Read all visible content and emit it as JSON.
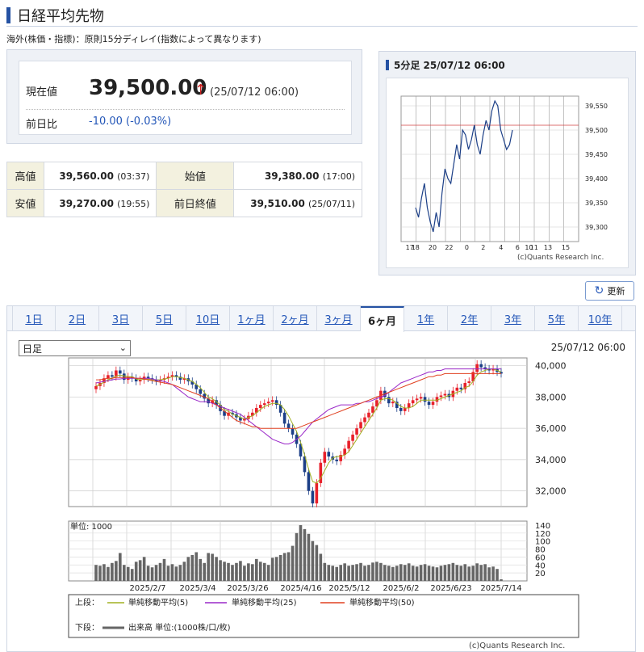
{
  "header": {
    "title": "日経平均先物",
    "note": "海外(株価・指標)：原則15分ディレイ(指数によって異なります)"
  },
  "quote": {
    "current_label": "現在値",
    "price": "39,500.00",
    "arrow": "↑",
    "date": "(25/07/12 06:00)",
    "change_label": "前日比",
    "change": "-10.00 (-0.03%)"
  },
  "stats": {
    "high_label": "高値",
    "high": "39,560.00",
    "high_time": "(03:37)",
    "open_label": "始値",
    "open": "39,380.00",
    "open_time": "(17:00)",
    "low_label": "安値",
    "low": "39,270.00",
    "low_time": "(19:55)",
    "prev_label": "前日終値",
    "prev": "39,510.00",
    "prev_time": "(25/07/11)"
  },
  "intraday": {
    "title": "5分足 25/07/12 06:00",
    "copyright": "(c)Quants Research Inc.",
    "x_ticks": [
      "17",
      "18",
      "20",
      "22",
      "0",
      "2",
      "4",
      "6",
      "10",
      "11",
      "13",
      "15"
    ],
    "y_ticks": [
      "39,550",
      "39,500",
      "39,450",
      "39,400",
      "39,350",
      "39,300"
    ]
  },
  "refresh_label": "更新",
  "tabs": [
    "1日",
    "2日",
    "3日",
    "5日",
    "10日",
    "1ヶ月",
    "2ヶ月",
    "3ヶ月",
    "6ヶ月",
    "1年",
    "2年",
    "3年",
    "5年",
    "10年"
  ],
  "active_tab": "6ヶ月",
  "select_value": "日足",
  "chart_date": "25/07/12 06:00",
  "legend": {
    "upper_label": "上段：",
    "sma5": "単純移動平均(5)",
    "sma25": "単純移動平均(25)",
    "sma50": "単純移動平均(50)",
    "lower_label": "下段：",
    "volume": "出来高 単位:(1000株/口/枚)"
  },
  "volume_unit": "単位: 1000",
  "copyright": "(c)Quants Research Inc.",
  "colors": {
    "up": "#e8202a",
    "down": "#1c3f87",
    "sma5": "#a0b020",
    "sma25": "#9a28c8",
    "sma50": "#e04020",
    "accent": "#2552a3"
  },
  "chart_data": [
    {
      "type": "line",
      "title": "5分足 25/07/12 06:00",
      "y_ticks": [
        39300,
        39350,
        39400,
        39450,
        39500,
        39550
      ],
      "ylim": [
        39270,
        39570
      ],
      "x_ticks": [
        "17",
        "18",
        "20",
        "22",
        "0",
        "2",
        "4",
        "6",
        "10",
        "11",
        "13",
        "15"
      ],
      "reference_line": 39510,
      "series": [
        {
          "values": [
            39340,
            39320,
            39360,
            39390,
            39340,
            39310,
            39290,
            39330,
            39300,
            39370,
            39420,
            39400,
            39390,
            39430,
            39470,
            39440,
            39500,
            39490,
            39460,
            39480,
            39510,
            39470,
            39450,
            39490,
            39520,
            39500,
            39540,
            39560,
            39550,
            39500,
            39480,
            39460,
            39470,
            39500
          ]
        }
      ]
    },
    {
      "type": "candlestick",
      "title": "日足",
      "ylim": [
        31000,
        40500
      ],
      "y_ticks": [
        32000,
        34000,
        36000,
        38000,
        40000
      ],
      "x_ticks": [
        "2025/2/7",
        "2025/3/4",
        "2025/3/26",
        "2025/4/16",
        "2025/5/12",
        "2025/6/2",
        "2025/6/23",
        "2025/7/14"
      ],
      "close": [
        38700,
        38900,
        39200,
        39400,
        39300,
        39700,
        39500,
        39100,
        39300,
        39200,
        39000,
        39100,
        39300,
        39200,
        39100,
        39000,
        39100,
        39200,
        39300,
        39400,
        39300,
        39100,
        39200,
        39000,
        38800,
        38500,
        38200,
        37900,
        37600,
        37800,
        37500,
        37100,
        36800,
        37000,
        36900,
        36700,
        36500,
        36600,
        36800,
        37000,
        37300,
        37500,
        37600,
        37700,
        37800,
        37500,
        37000,
        36300,
        36000,
        35600,
        35000,
        34200,
        33200,
        32000,
        31200,
        32500,
        33800,
        34500,
        34200,
        34000,
        33900,
        34300,
        34700,
        35200,
        35600,
        36000,
        36400,
        36700,
        37000,
        37400,
        37800,
        38400,
        38000,
        37600,
        37700,
        37300,
        37100,
        37300,
        37600,
        37800,
        37900,
        38000,
        37700,
        37500,
        37700,
        38000,
        38100,
        38200,
        38000,
        38400,
        38600,
        38500,
        38900,
        39000,
        39600,
        40100,
        39900,
        39800,
        39700,
        39800,
        39600,
        39500
      ],
      "series": [
        {
          "name": "単純移動平均(5)",
          "values": [
            38700,
            38800,
            38950,
            39100,
            39200,
            39350,
            39400,
            39350,
            39300,
            39300,
            39150,
            39100,
            39150,
            39150,
            39100,
            39100,
            39100,
            39150,
            39200,
            39300,
            39300,
            39250,
            39200,
            39100,
            39000,
            38800,
            38600,
            38300,
            38000,
            37900,
            37700,
            37500,
            37200,
            37100,
            36900,
            36800,
            36700,
            36600,
            36700,
            36800,
            37000,
            37200,
            37400,
            37500,
            37600,
            37600,
            37500,
            37200,
            36800,
            36300,
            35800,
            35100,
            34300,
            33400,
            32600,
            32500,
            32800,
            33300,
            33800,
            34100,
            34200,
            34200,
            34300,
            34500,
            34900,
            35300,
            35700,
            36100,
            36500,
            36900,
            37300,
            37800,
            37900,
            37900,
            37800,
            37600,
            37400,
            37300,
            37300,
            37400,
            37600,
            37800,
            37800,
            37800,
            37800,
            37800,
            37900,
            38000,
            38100,
            38200,
            38300,
            38400,
            38600,
            38700,
            39000,
            39400,
            39600,
            39700,
            39800,
            39800,
            39700,
            39600
          ]
        },
        {
          "name": "単純移動平均(25)",
          "values": [
            38900,
            38950,
            39000,
            39050,
            39100,
            39150,
            39150,
            39200,
            39200,
            39200,
            39200,
            39200,
            39200,
            39200,
            39150,
            39100,
            39050,
            39000,
            38900,
            38800,
            38600,
            38400,
            38200,
            38000,
            37900,
            37800,
            37700,
            37700,
            37700,
            37600,
            37500,
            37400,
            37300,
            37200,
            37100,
            37000,
            36900,
            36700,
            36500,
            36300,
            36100,
            35900,
            35700,
            35500,
            35300,
            35200,
            35100,
            35000,
            35000,
            35100,
            35300,
            35500,
            35800,
            36100,
            36400,
            36600,
            36800,
            37000,
            37200,
            37300,
            37400,
            37500,
            37500,
            37500,
            37500,
            37600,
            37600,
            37700,
            37700,
            37800,
            37900,
            38000,
            38100,
            38300,
            38500,
            38700,
            38900,
            39000,
            39100,
            39200,
            39300,
            39400,
            39500,
            39600,
            39600,
            39700,
            39700,
            39800,
            39800,
            39800,
            39800,
            39800,
            39800,
            39800,
            39800,
            39800,
            39800,
            39800,
            39800,
            39800,
            39800,
            39800
          ]
        },
        {
          "name": "単純移動平均(50)",
          "values": [
            39100,
            39100,
            39150,
            39200,
            39200,
            39250,
            39250,
            39250,
            39250,
            39250,
            39200,
            39200,
            39150,
            39100,
            39050,
            39000,
            38950,
            38900,
            38850,
            38800,
            38700,
            38600,
            38500,
            38400,
            38300,
            38200,
            38100,
            38000,
            37900,
            37700,
            37500,
            37300,
            37100,
            36900,
            36700,
            36500,
            36400,
            36300,
            36200,
            36100,
            36100,
            36000,
            36000,
            36000,
            36000,
            36000,
            36000,
            36000,
            36000,
            36000,
            36000,
            36100,
            36200,
            36300,
            36400,
            36500,
            36600,
            36700,
            36800,
            36900,
            37000,
            37100,
            37200,
            37300,
            37400,
            37500,
            37600,
            37700,
            37800,
            37900,
            38000,
            38100,
            38200,
            38300,
            38400,
            38500,
            38600,
            38700,
            38800,
            38900,
            39000,
            39100,
            39200,
            39300,
            39300,
            39400,
            39400,
            39500,
            39500,
            39500,
            39500,
            39500,
            39500,
            39500,
            39500,
            39500,
            39500,
            39500,
            39500,
            39500,
            39500,
            39500
          ]
        }
      ]
    },
    {
      "type": "bar",
      "title": "出来高",
      "ylabel": "単位: 1000",
      "ylim": [
        0,
        150
      ],
      "y_ticks": [
        20,
        40,
        60,
        80,
        100,
        120,
        140
      ],
      "values": [
        40,
        38,
        42,
        35,
        45,
        50,
        70,
        40,
        35,
        30,
        48,
        52,
        60,
        38,
        34,
        40,
        45,
        55,
        38,
        42,
        36,
        40,
        48,
        60,
        65,
        72,
        55,
        45,
        70,
        68,
        60,
        52,
        48,
        45,
        40,
        45,
        50,
        38,
        44,
        42,
        55,
        48,
        45,
        40,
        58,
        60,
        65,
        70,
        72,
        88,
        120,
        140,
        130,
        118,
        100,
        90,
        68,
        45,
        40,
        38,
        35,
        40,
        44,
        38,
        40,
        42,
        45,
        38,
        40,
        46,
        48,
        45,
        40,
        38,
        35,
        38,
        42,
        40,
        44,
        38,
        36,
        40,
        42,
        38,
        36,
        34,
        38,
        40,
        42,
        45,
        40,
        38,
        42,
        36,
        38,
        44,
        40,
        42,
        34,
        36,
        30,
        4
      ]
    }
  ]
}
